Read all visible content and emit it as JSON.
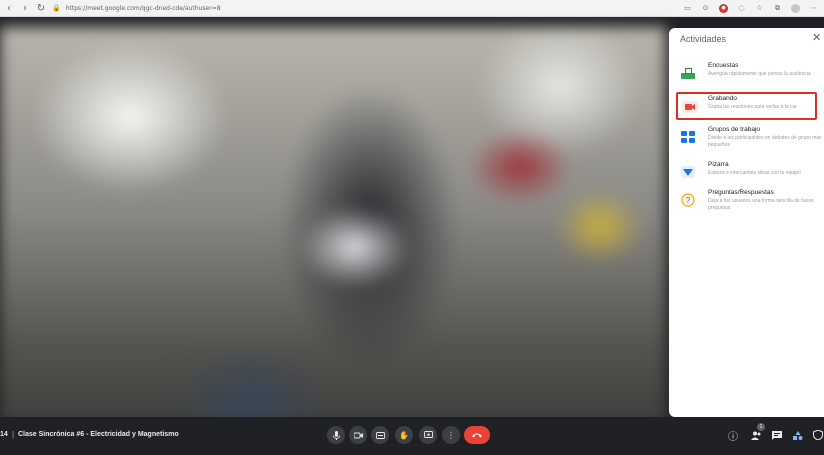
{
  "browser": {
    "url": "https://meet.google.com/qgc-dned-cde/authuser=8"
  },
  "panel": {
    "title": "Actividades",
    "items": [
      {
        "title": "Encuestas",
        "desc": "Averigua rápidamente qué piensa la audiencia",
        "icon": "poll-icon",
        "highlighted": false
      },
      {
        "title": "Grabando",
        "desc": "Graba las reuniones para verlas a la car",
        "icon": "record-icon",
        "highlighted": true
      },
      {
        "title": "Grupos de trabajo",
        "desc": "Divide a los participantes en debates de grupo más pequeños",
        "icon": "breakout-rooms-icon",
        "highlighted": false
      },
      {
        "title": "Pizarra",
        "desc": "Esboza e intercambia ideas con tu equipo",
        "icon": "whiteboard-icon",
        "highlighted": false
      },
      {
        "title": "Preguntas/Respuestas",
        "desc": "Deja a tus usuarios una forma sencilla de hacer preguntas",
        "icon": "qa-icon",
        "highlighted": false
      }
    ]
  },
  "meeting": {
    "time": "14",
    "separator": "|",
    "title": "Clase Sincrónica #6 - Electricidad y Magnetismo"
  },
  "people_count": "1",
  "colors": {
    "toolbar_bg": "#202124",
    "end_call": "#ea4335",
    "highlight_box": "#d93025",
    "panel_bg": "#ffffff"
  }
}
